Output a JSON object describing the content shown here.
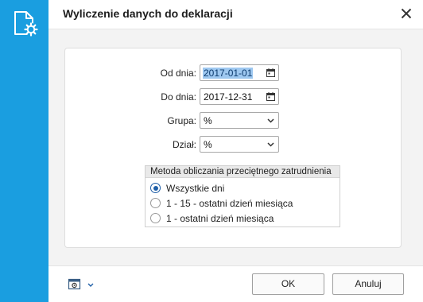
{
  "dialog": {
    "title": "Wyliczenie danych do deklaracji"
  },
  "form": {
    "date_from_label": "Od dnia:",
    "date_from_value": "2017-01-01",
    "date_to_label": "Do dnia:",
    "date_to_value": "2017-12-31",
    "group_label": "Grupa:",
    "group_value": "%",
    "department_label": "Dział:",
    "department_value": "%"
  },
  "method": {
    "header": "Metoda obliczania przeciętnego zatrudnienia",
    "options": [
      {
        "label": "Wszystkie dni",
        "checked": true
      },
      {
        "label": "1 - 15 - ostatni dzień miesiąca",
        "checked": false
      },
      {
        "label": "1 - ostatni dzień miesiąca",
        "checked": false
      }
    ]
  },
  "footer": {
    "ok_label": "OK",
    "cancel_label": "Anuluj"
  },
  "icons": {
    "sidebar": "document-gear-icon",
    "close": "close-icon",
    "calendar": "calendar-icon",
    "dropdown": "chevron-down-icon",
    "settings": "settings-window-icon"
  },
  "colors": {
    "accent": "#1a9ee0",
    "selection": "#9ec8f0",
    "radio_checked": "#1f5fa8"
  }
}
